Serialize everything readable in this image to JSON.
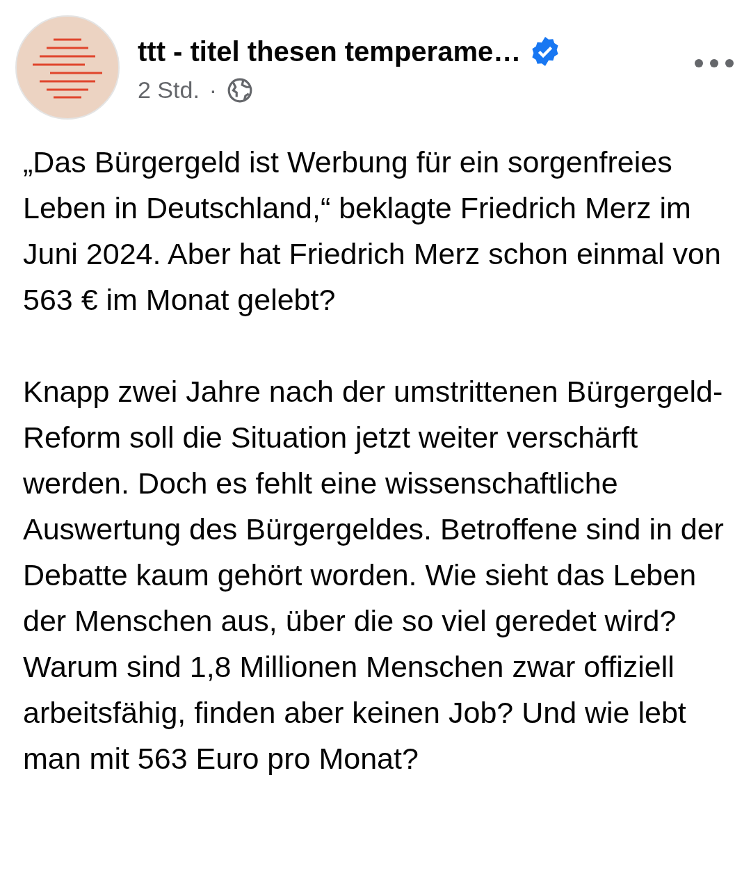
{
  "post": {
    "author": "ttt - titel thesen temperame…",
    "verified": true,
    "time": "2 Std.",
    "separator": "·",
    "paragraphs": [
      "„Das Bürgergeld ist Werbung für ein sorgenfreies Leben in Deutschland,“ beklagte Friedrich Merz im Juni 2024. Aber hat Friedrich Merz schon einmal von 563 € im Monat gelebt?",
      "Knapp zwei Jahre nach der umstrittenen Bürgergeld-Reform soll die Situation jetzt weiter verschärft werden. Doch es fehlt eine wissenschaftliche Auswertung des Bürgergeldes. Betroffene sind in der Debatte kaum gehört worden. Wie sieht das Leben der Menschen aus, über die so viel geredet wird? Warum sind 1,8 Millionen Menschen zwar offiziell arbeitsfähig, finden aber keinen Job? Und wie lebt man mit 563 Euro pro Monat?"
    ]
  }
}
